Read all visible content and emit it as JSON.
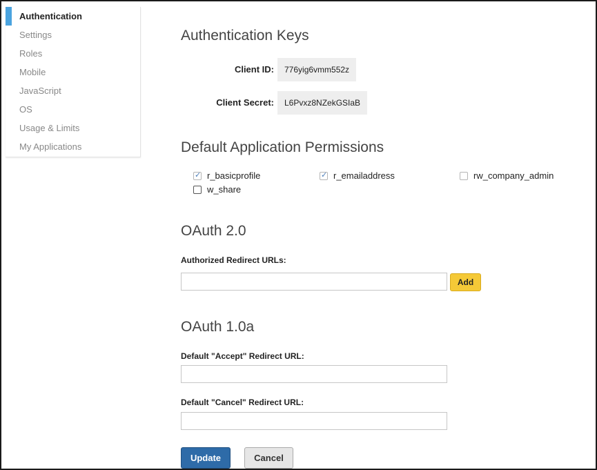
{
  "sidebar": {
    "items": [
      {
        "label": "Authentication",
        "active": true
      },
      {
        "label": "Settings"
      },
      {
        "label": "Roles"
      },
      {
        "label": "Mobile"
      },
      {
        "label": "JavaScript"
      },
      {
        "label": "OS"
      },
      {
        "label": "Usage & Limits"
      },
      {
        "label": "My Applications"
      }
    ]
  },
  "auth_keys": {
    "title": "Authentication Keys",
    "client_id_label": "Client ID:",
    "client_id_value": "776yig6vmm552z",
    "client_secret_label": "Client Secret:",
    "client_secret_value": "L6Pvxz8NZekGSIaB"
  },
  "permissions": {
    "title": "Default Application Permissions",
    "items": [
      {
        "label": "r_basicprofile",
        "checked": true
      },
      {
        "label": "r_emailaddress",
        "checked": true
      },
      {
        "label": "rw_company_admin",
        "checked": false
      },
      {
        "label": "w_share",
        "checked": false
      }
    ]
  },
  "oauth2": {
    "title": "OAuth 2.0",
    "redirect_label": "Authorized Redirect URLs:",
    "redirect_value": "",
    "add_label": "Add"
  },
  "oauth1": {
    "title": "OAuth 1.0a",
    "accept_label": "Default \"Accept\" Redirect URL:",
    "accept_value": "",
    "cancel_label": "Default \"Cancel\" Redirect URL:",
    "cancel_value": ""
  },
  "actions": {
    "update_label": "Update",
    "cancel_label": "Cancel"
  },
  "colors": {
    "active_marker": "#4aa3df",
    "add_button": "#f5c937",
    "update_button": "#2e6ba8"
  }
}
